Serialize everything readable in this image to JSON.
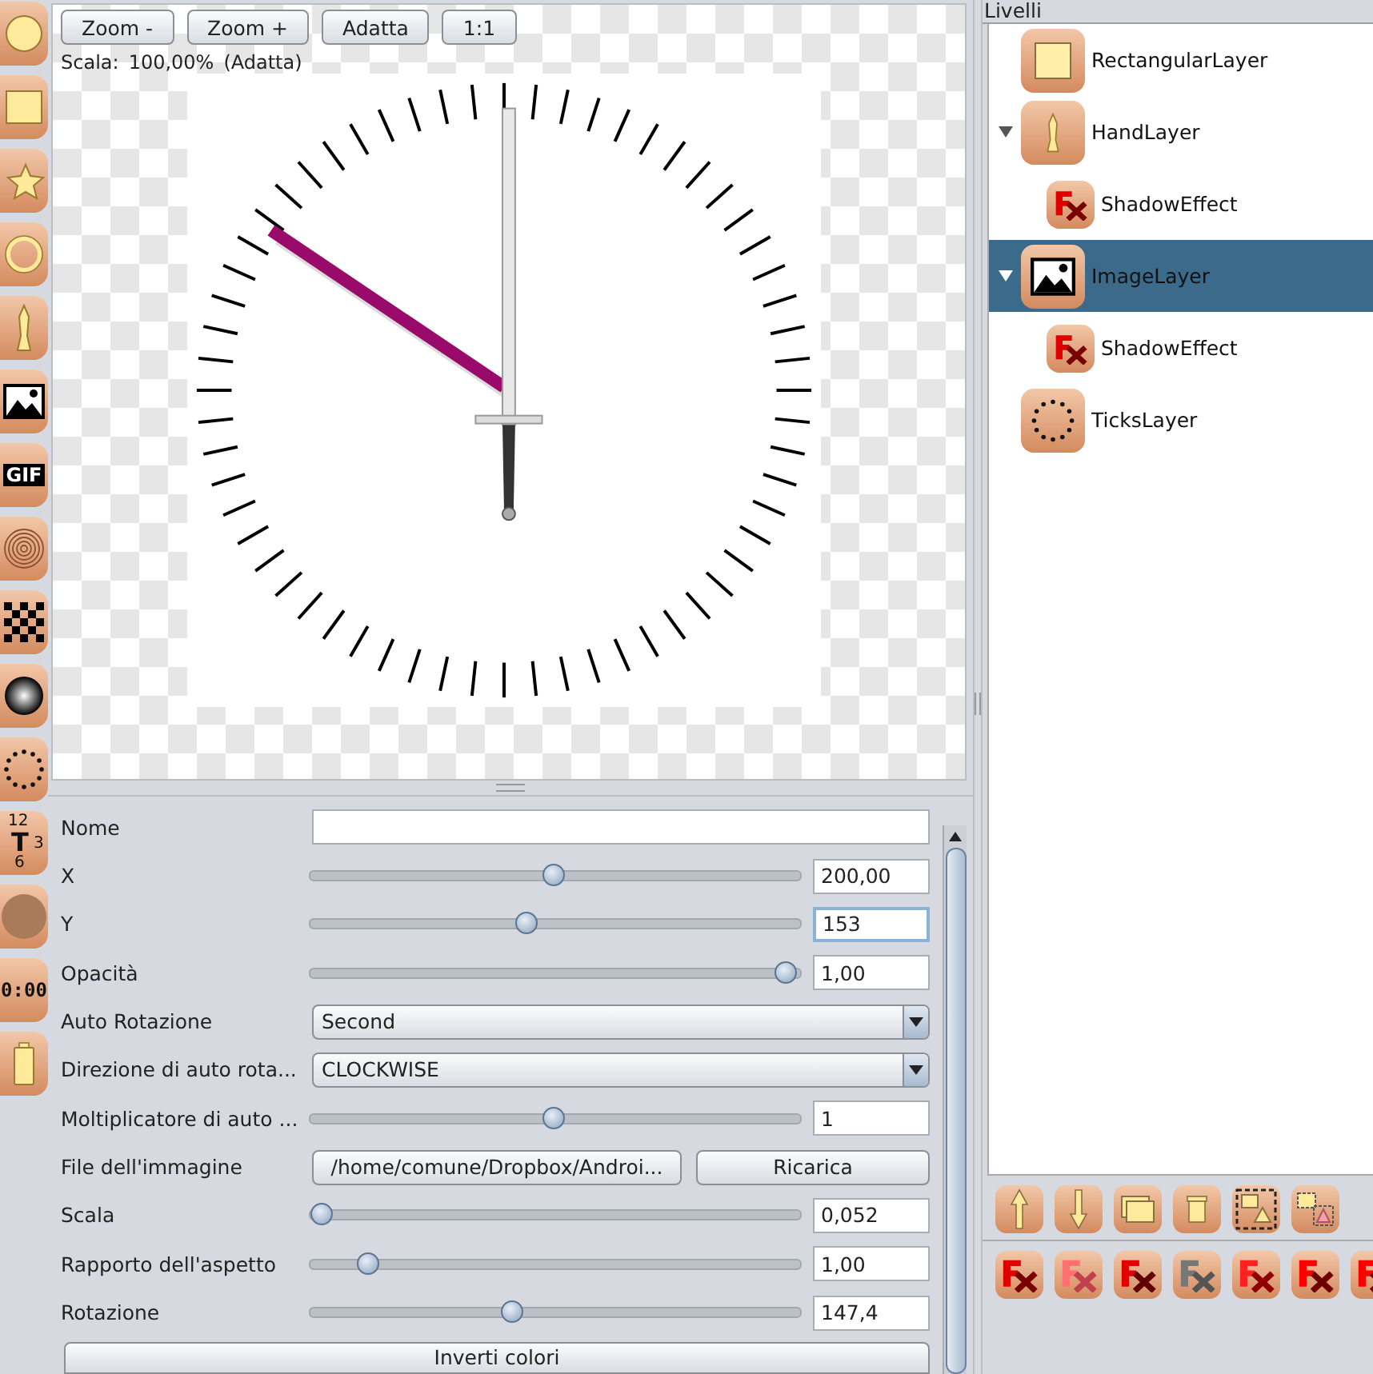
{
  "tools": [
    {
      "kind": "circle"
    },
    {
      "kind": "rectangle"
    },
    {
      "kind": "stars"
    },
    {
      "kind": "ring"
    },
    {
      "kind": "hand"
    },
    {
      "kind": "image"
    },
    {
      "kind": "gif",
      "label": "GIF"
    },
    {
      "kind": "rings"
    },
    {
      "kind": "checker"
    },
    {
      "kind": "sphere"
    },
    {
      "kind": "ticks"
    },
    {
      "kind": "text",
      "labels": [
        "12",
        "T",
        "3",
        "6"
      ]
    },
    {
      "kind": "dial"
    },
    {
      "kind": "digital",
      "label": "0:00"
    },
    {
      "kind": "battery"
    }
  ],
  "canvas": {
    "buttons": [
      "Zoom -",
      "Zoom +",
      "Adatta",
      "1:1"
    ],
    "scale_label": "Scala:",
    "scale_value": "100,00%",
    "scale_mode": "(Adatta)"
  },
  "properties": [
    {
      "kind": "text",
      "label": "Nome",
      "focused": false
    },
    {
      "kind": "slider",
      "label": "X",
      "level": 0.5,
      "value": "200,00",
      "focused": false
    },
    {
      "kind": "slider",
      "label": "Y",
      "level": 0.44,
      "value": "153",
      "focused": true
    },
    {
      "kind": "slider",
      "label": "Opacità",
      "level": 1,
      "value": "1,00",
      "focused": false
    },
    {
      "kind": "combo",
      "label": "Auto Rotazione",
      "value": "Second"
    },
    {
      "kind": "combo",
      "label": "Direzione di auto rota...",
      "value": "CLOCKWISE"
    },
    {
      "kind": "slider",
      "label": "Moltiplicatore di auto ...",
      "level": 0.5,
      "value": "1",
      "focused": false
    },
    {
      "kind": "file",
      "label": "File dell'immagine",
      "value": "/home/comune/Dropbox/Androi...",
      "button": "Ricarica"
    },
    {
      "kind": "slider",
      "label": "Scala",
      "level": 0,
      "value": "0,052",
      "focused": false
    },
    {
      "kind": "slider",
      "label": "Rapporto dell'aspetto",
      "level": 0.1,
      "value": "1,00",
      "focused": false
    },
    {
      "kind": "slider",
      "label": "Rotazione",
      "level": 0.41,
      "value": "147,4",
      "focused": false
    },
    {
      "kind": "button",
      "value": "Inverti colori"
    }
  ],
  "layers": {
    "title": "Livelli",
    "items": [
      {
        "kind": "rectangle",
        "name": "RectangularLayer",
        "selected": false
      },
      {
        "kind": "hand",
        "name": "HandLayer",
        "selected": false,
        "expanded": true,
        "children": [
          {
            "kind": "effect",
            "name": "ShadowEffect",
            "selected": false
          }
        ]
      },
      {
        "kind": "image",
        "name": "ImageLayer",
        "selected": true,
        "expanded": true,
        "children": [
          {
            "kind": "effect",
            "name": "ShadowEffect",
            "selected": false
          }
        ]
      },
      {
        "kind": "ticks",
        "name": "TicksLayer",
        "selected": false
      }
    ]
  }
}
